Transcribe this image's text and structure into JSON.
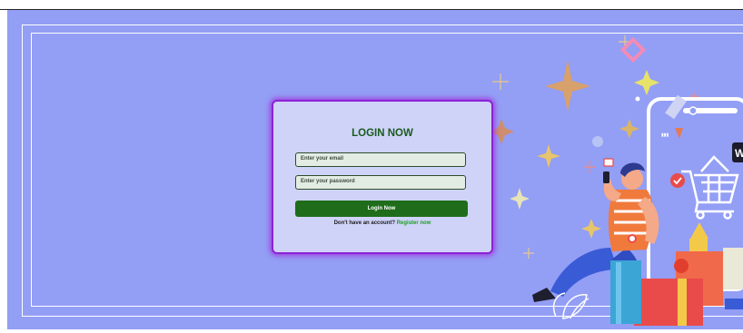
{
  "login": {
    "title": "LOGIN NOW",
    "email_placeholder": "Enter your email",
    "password_placeholder": "Enter your password",
    "submit_label": "Login Now",
    "register_prompt": "Don't have an account?",
    "register_link": "Register now"
  },
  "colors": {
    "background": "#939ef5",
    "card": "#cfd3f8",
    "card_border": "#8c22d6",
    "primary": "#1f6d1a",
    "link": "#1f9e22"
  },
  "icons": [
    "sparkle-icon",
    "shopping-cart-icon",
    "check-badge-icon",
    "gift-box-icon",
    "phone-icon"
  ]
}
